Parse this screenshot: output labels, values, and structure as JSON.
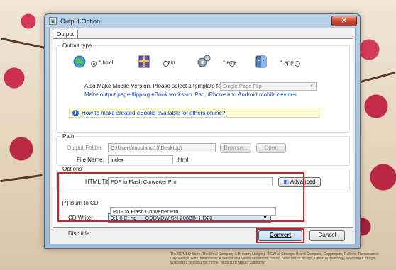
{
  "window": {
    "title": "Output Option",
    "close_label": "✕"
  },
  "tabs": [
    {
      "label": "Output"
    }
  ],
  "output_type": {
    "group_label": "Output type",
    "options": [
      {
        "label": "*.html",
        "selected": true,
        "icon": "globe-icon"
      },
      {
        "label": "*.zip",
        "selected": false,
        "icon": "zip-archive-icon"
      },
      {
        "label": "*.exe",
        "selected": false,
        "icon": "exe-program-icon"
      },
      {
        "label": "*.app",
        "selected": false,
        "icon": "mac-app-icon"
      }
    ],
    "mobile_checkbox_label": "Also Make Mobile Version. Please select a template for mobile:",
    "mobile_checked": false,
    "mobile_template": "Single Page Flip",
    "mobile_note": "Make output page-flipping eBook works on iPad, iPhone and Android mobile devices",
    "help_link": "How to make created eBooks available for others online?"
  },
  "path": {
    "group_label": "Path",
    "output_folder_label": "Output Folder:",
    "output_folder_value": "C:\\Users\\mobiano13\\Desktop\\",
    "browse_label": "Browse...",
    "open_label": "Open",
    "file_name_label": "File Name:",
    "file_name_value": "index",
    "file_ext": ".html"
  },
  "options": {
    "group_label": "Options",
    "html_title_label": "HTML Title:",
    "html_title_value": "PDF to Flash Converter Pro",
    "advanced_label": "Advanced"
  },
  "burn": {
    "checkbox_label": "Burn to CD",
    "checked": true,
    "cd_writer_label": "CD Writer",
    "cd_writer_value": "0:1:0,E: hp      CDDVDW SN-208BB  HD20",
    "disc_title_label": "Disc title:",
    "disc_title_value": "PDF to Flash Converter Pro"
  },
  "footer": {
    "convert_label": "Convert",
    "cancel_label": "Cancel"
  },
  "background_text": "The ROMEO Store, The Shoe Company & Brewery Lodging - NEW at Chicago, Brand Compass, Coppergate, Gallerie, Renaissance Day Vintage Gifts, Innervision: A Sensor and Views Showroom, Studio Seventeen Chicago, Urban Archaeology, Welcome Chicago, Wisconsin, Woodburner Home, Woodburn Artisan Cabinetry",
  "colors": {
    "highlight": "#d22020",
    "link": "#0b3cc2"
  }
}
